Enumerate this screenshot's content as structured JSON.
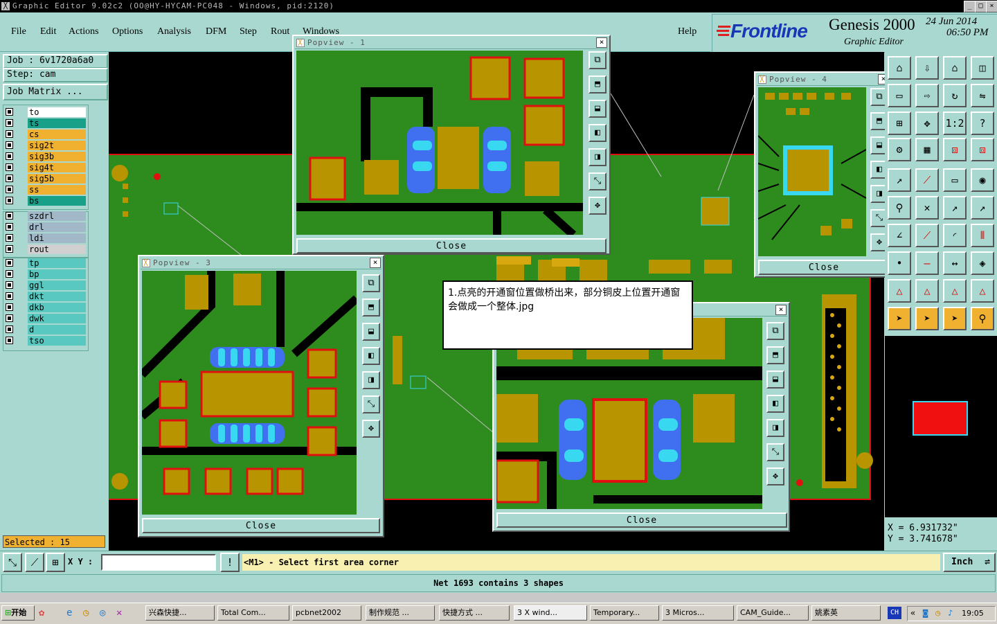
{
  "window": {
    "title": "Graphic Editor 9.02c2 (OO@HY-HYCAM-PC048 - Windows, pid:2120)"
  },
  "menu": [
    "File",
    "Edit",
    "Actions",
    "Options",
    "Analysis",
    "DFM",
    "Step",
    "Rout",
    "Windows"
  ],
  "help_label": "Help",
  "brand": {
    "logo": "Frontline",
    "product": "Genesis 2000",
    "subtitle": "Graphic Editor",
    "date": "24 Jun 2014",
    "time": "06:50 PM"
  },
  "job": {
    "job_text": "Job : 6v1720a6a0",
    "step_text": "Step: cam",
    "matrix_btn": "Job Matrix ..."
  },
  "layers_group1": [
    {
      "name": "to",
      "color": "#ffffff"
    },
    {
      "name": "ts",
      "color": "#18a088"
    },
    {
      "name": "cs",
      "color": "#f0b030"
    },
    {
      "name": "sig2t",
      "color": "#f0b030"
    },
    {
      "name": "sig3b",
      "color": "#f0b030"
    },
    {
      "name": "sig4t",
      "color": "#f0b030"
    },
    {
      "name": "sig5b",
      "color": "#f0b030"
    },
    {
      "name": "ss",
      "color": "#f0b030"
    },
    {
      "name": "bs",
      "color": "#18a088"
    }
  ],
  "layers_group2": [
    {
      "name": "szdrl",
      "color": "#a0b8c8"
    },
    {
      "name": "drl",
      "color": "#a0b8c8"
    },
    {
      "name": "ldi",
      "color": "#a0b8c8"
    },
    {
      "name": "rout",
      "color": "#d0d0d0"
    }
  ],
  "layers_group3": [
    {
      "name": "tp",
      "color": "#58c8c0"
    },
    {
      "name": "bp",
      "color": "#58c8c0"
    },
    {
      "name": "ggl",
      "color": "#58c8c0"
    },
    {
      "name": "dkt",
      "color": "#58c8c0"
    },
    {
      "name": "dkb",
      "color": "#58c8c0"
    },
    {
      "name": "dwk",
      "color": "#58c8c0"
    },
    {
      "name": "d",
      "color": "#58c8c0"
    },
    {
      "name": "tso",
      "color": "#58c8c0"
    }
  ],
  "selected_text": "Selected : 15",
  "popviews": {
    "p1": {
      "title": "Popview - 1",
      "close": "Close"
    },
    "p3": {
      "title": "Popview - 3",
      "close": "Close"
    },
    "p4": {
      "title": "Popview - 4",
      "close": "Close"
    },
    "p2": {
      "close": "Close"
    }
  },
  "note": "1.点亮的开通窗位置做桥出来，部分铜皮上位置开通窗会做成一个整体.jpg",
  "coords": {
    "x": "X = 6.931732\"",
    "y": "Y = 3.741678\""
  },
  "cmd": {
    "xy_label": "X Y :",
    "xy_value": "",
    "prompt": "<M1> - Select first area corner",
    "unit": "Inch"
  },
  "status_msg": "Net 1693 contains 3 shapes",
  "taskbar": {
    "start": "开始",
    "tasks": [
      "兴森快捷...",
      "Total Com...",
      "pcbnet2002",
      "制作规范 ...",
      "快捷方式 ...",
      "3 X wind...",
      "Temporary...",
      "3 Micros...",
      "CAM_Guide...",
      "姚素英"
    ],
    "lang": "CH",
    "clock": "19:05"
  },
  "colors": {
    "board": "#2e8c1e",
    "copper": "#b89400",
    "highlight_blue": "#4070f0",
    "highlight_cyan": "#38d8f0",
    "outline_red": "#e01010",
    "panel": "#a8d8d0"
  }
}
